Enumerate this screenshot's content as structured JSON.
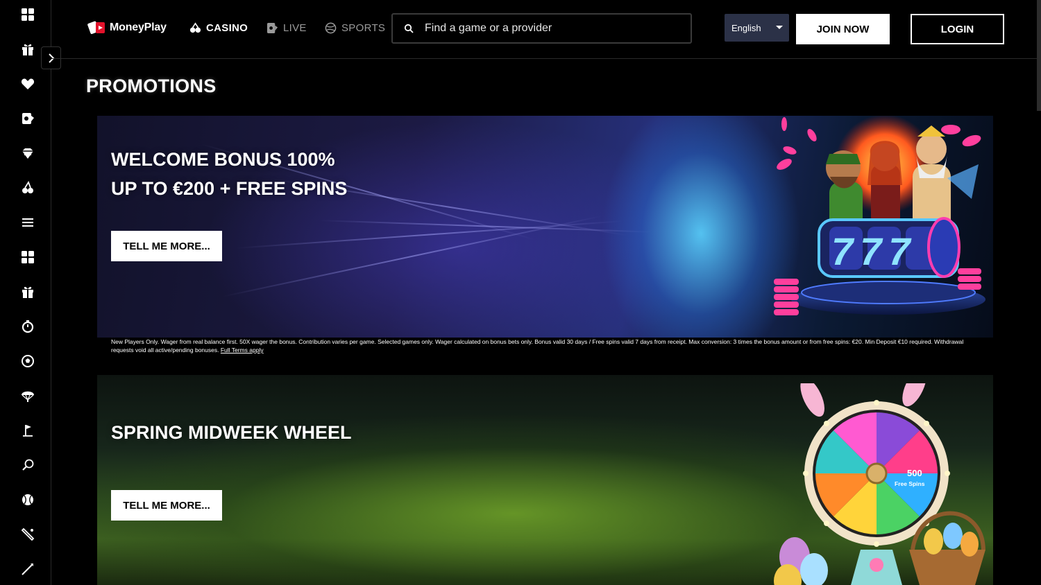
{
  "header": {
    "logo_text": "MoneyPlay",
    "nav": [
      {
        "label": "CASINO"
      },
      {
        "label": "LIVE"
      },
      {
        "label": "SPORTS"
      }
    ],
    "search_placeholder": "Find a game or a provider",
    "language": "English",
    "join_label": "JOIN NOW",
    "login_label": "LOGIN"
  },
  "sidebar": {
    "icons": [
      "grid-icon",
      "gift-icon",
      "heart-icon",
      "live-card-icon",
      "diamond-icon",
      "cherries-icon",
      "menu-icon",
      "grid-icon",
      "gift-icon",
      "stopwatch-icon",
      "football-icon",
      "parachute-icon",
      "golf-icon",
      "badminton-icon",
      "baseball-icon",
      "bat-icon",
      "javelin-icon"
    ]
  },
  "main": {
    "title": "PROMOTIONS",
    "promos": [
      {
        "heading_line1": "WELCOME BONUS 100%",
        "heading_line2": "UP TO €200 + FREE SPINS",
        "cta": "TELL ME MORE...",
        "terms": "New Players Only. Wager from real balance first. 50X wager the bonus. Contribution varies per game. Selected games only. Wager calculated on bonus bets only. Bonus valid 30 days / Free spins valid 7 days from receipt. Max conversion: 3 times the bonus amount or from free spins: €20. Min Deposit €10 required. Withdrawal requests void all active/pending bonuses.",
        "terms_link": "Full Terms apply",
        "slot_text": "777"
      },
      {
        "heading_line1": "SPRING MIDWEEK WHEEL",
        "cta": "TELL ME MORE...",
        "wheel_center": "500",
        "wheel_center_sub": "Free Spins"
      }
    ]
  },
  "colors": {
    "background": "#000000",
    "language_bg": "#2b3147",
    "brand_red": "#e3122b"
  }
}
